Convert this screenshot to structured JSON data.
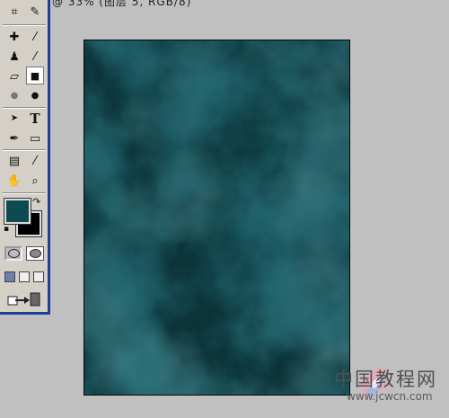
{
  "window": {
    "title_fragment": "@ 33% (图层 5, RGB/8)"
  },
  "toolbox": {
    "tools": [
      {
        "name": "crop-tool",
        "icon": "crop-icon",
        "glyph": "⌗"
      },
      {
        "name": "slice-tool",
        "icon": "slice-icon",
        "glyph": "✎"
      },
      {
        "name": "healing-brush-tool",
        "icon": "bandage-icon",
        "glyph": "✚"
      },
      {
        "name": "brush-tool",
        "icon": "brush-icon",
        "glyph": "⁄"
      },
      {
        "name": "clone-stamp-tool",
        "icon": "stamp-icon",
        "glyph": "♟"
      },
      {
        "name": "history-brush-tool",
        "icon": "history-brush-icon",
        "glyph": "⁄"
      },
      {
        "name": "eraser-tool",
        "icon": "eraser-icon",
        "glyph": "▱"
      },
      {
        "name": "gradient-tool",
        "icon": "gradient-icon",
        "glyph": "■"
      },
      {
        "name": "blur-tool",
        "icon": "drop-icon",
        "glyph": "●"
      },
      {
        "name": "dodge-tool",
        "icon": "dodge-icon",
        "glyph": "●"
      },
      {
        "name": "path-selection-tool",
        "icon": "arrow-icon",
        "glyph": "➤"
      },
      {
        "name": "type-tool",
        "icon": "type-icon",
        "glyph": "T"
      },
      {
        "name": "pen-tool",
        "icon": "pen-icon",
        "glyph": "✒"
      },
      {
        "name": "rectangle-tool",
        "icon": "rectangle-icon",
        "glyph": "▭"
      },
      {
        "name": "notes-tool",
        "icon": "notes-icon",
        "glyph": "▤"
      },
      {
        "name": "eyedropper-tool",
        "icon": "eyedropper-icon",
        "glyph": "⁄"
      },
      {
        "name": "hand-tool",
        "icon": "hand-icon",
        "glyph": "✋"
      },
      {
        "name": "zoom-tool",
        "icon": "magnifier-icon",
        "glyph": "⌕"
      }
    ],
    "foreground_color": "#0e4a52",
    "background_color": "#000000",
    "swap_glyph": "↷",
    "default_colors_glyph": "▪"
  },
  "canvas": {
    "base_color": "#0b3339",
    "cloud_light": "#1d5a63",
    "cloud_dark": "#050f12"
  },
  "watermark": {
    "text": "中国教程网",
    "url": "www.jcwcn.com"
  }
}
